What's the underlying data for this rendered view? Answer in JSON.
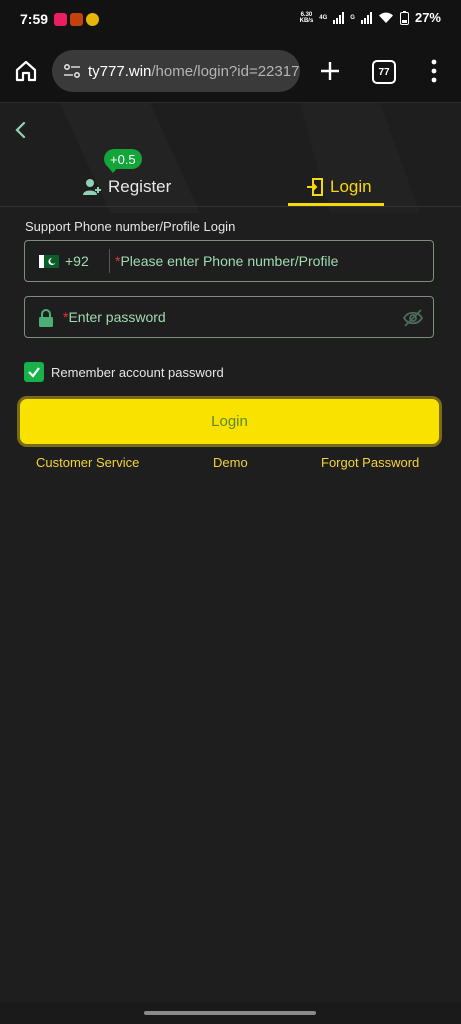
{
  "status": {
    "time": "7:59",
    "speed_top": "6.30",
    "speed_unit": "KB/s",
    "net1": "4G",
    "net2": "G",
    "battery": "27%"
  },
  "browser": {
    "domain": "ty777.win",
    "path": "/home/login?id=22317",
    "tab_count": "77"
  },
  "auth": {
    "bonus_badge": "+0.5",
    "tab_register": "Register",
    "tab_login": "Login",
    "support_label": "Support Phone number/Profile Login",
    "country_code": "+92",
    "required_mark": "*",
    "phone_placeholder": "Please enter Phone number/Profile",
    "password_placeholder": "Enter password",
    "remember_label": "Remember account password",
    "login_button": "Login",
    "customer_service": "Customer Service",
    "demo": "Demo",
    "forgot_password": "Forgot Password"
  },
  "colors": {
    "accent": "#f5d90a",
    "badge": "#13a53a",
    "placeholder": "#9fdcb0",
    "background": "#1e1e1e"
  }
}
